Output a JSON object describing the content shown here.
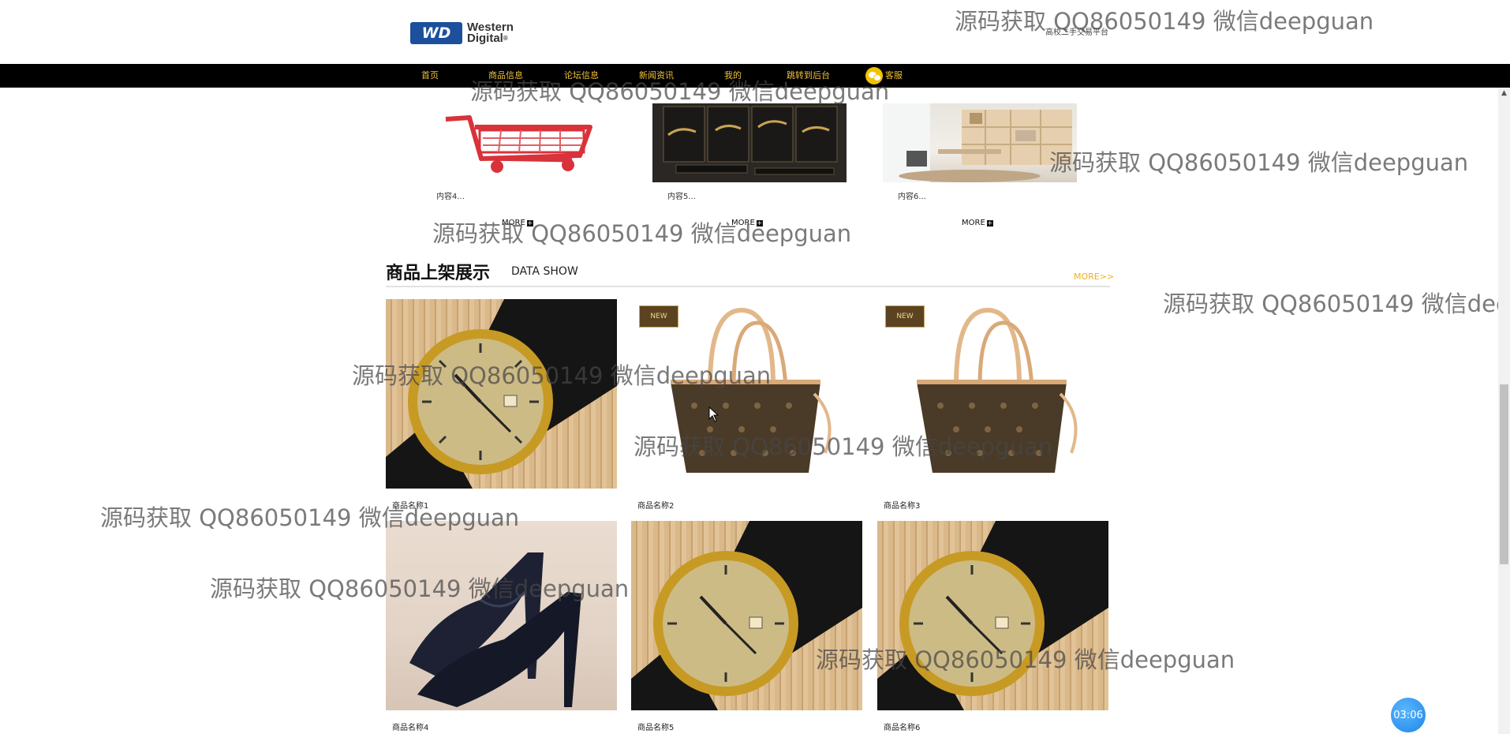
{
  "header": {
    "logo_badge": "WD",
    "logo_line1": "Western",
    "logo_line2": "Digital",
    "logo_tm": "®",
    "site_subtitle": "高校二手交易平台"
  },
  "nav": {
    "items": [
      "首页",
      "商品信息",
      "论坛信息",
      "新闻资讯",
      "我的",
      "跳转到后台"
    ],
    "service_label": "客服"
  },
  "top_row": {
    "items": [
      {
        "caption": "内容4...",
        "more": "MORE"
      },
      {
        "caption": "内容5...",
        "more": "MORE"
      },
      {
        "caption": "内容6...",
        "more": "MORE"
      }
    ]
  },
  "section": {
    "title": "商品上架展示",
    "subtitle": "DATA SHOW",
    "more": "MORE>>"
  },
  "products": [
    {
      "name": "商品名称1",
      "image": "gold-watch"
    },
    {
      "name": "商品名称2",
      "image": "monogram-tote-bag",
      "tag": "新品"
    },
    {
      "name": "商品名称3",
      "image": "monogram-tote-bag",
      "tag": "新品"
    },
    {
      "name": "商品名称4",
      "image": "black-high-heels"
    },
    {
      "name": "商品名称5",
      "image": "gold-watch"
    },
    {
      "name": "商品名称6",
      "image": "gold-watch"
    }
  ],
  "watermark": {
    "text": "源码获取 QQ86050149 微信deepguan"
  },
  "timer": {
    "value": "03:06"
  },
  "icons": {
    "service": "wechat-icon",
    "more": "plus-square-icon",
    "cursor": "mouse-pointer-icon",
    "scroll_up": "scroll-up-arrow-icon"
  }
}
